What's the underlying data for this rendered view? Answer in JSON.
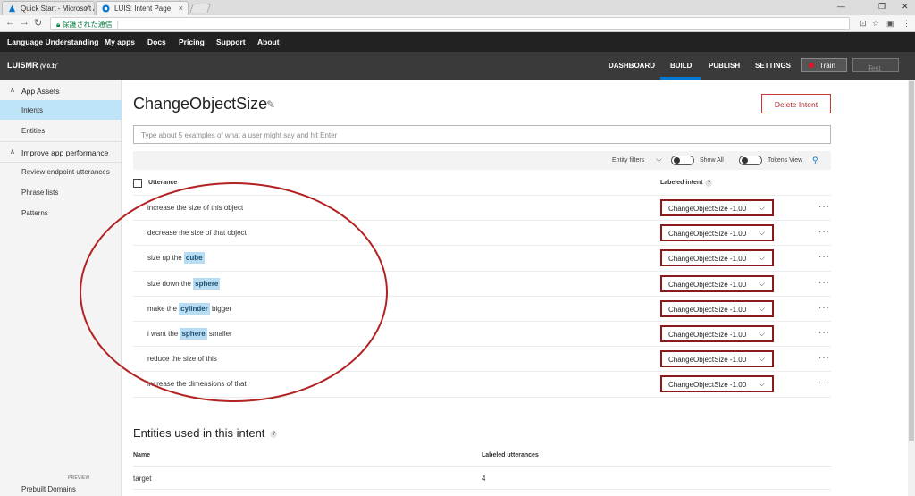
{
  "browser": {
    "tabs": [
      {
        "label": "Quick Start - Microsoft A"
      },
      {
        "label": "LUIS: Intent Page"
      }
    ],
    "url": {
      "secure_label": "保護された通信",
      "icon": "lock-icon"
    }
  },
  "topnav": {
    "brand": "Language Understanding",
    "links": [
      "My apps",
      "Docs",
      "Pricing",
      "Support",
      "About"
    ]
  },
  "appbar": {
    "app_name": "LUISMR",
    "version": "(V 0.1)",
    "tabs": [
      "DASHBOARD",
      "BUILD",
      "PUBLISH",
      "SETTINGS"
    ],
    "active_tab": "BUILD",
    "train_label": "Train",
    "test_label": "Test"
  },
  "sidebar": {
    "section1": "App Assets",
    "items1": [
      "Intents",
      "Entities"
    ],
    "selected": "Intents",
    "section2": "Improve app performance",
    "items2": [
      "Review endpoint utterances",
      "Phrase lists",
      "Patterns"
    ],
    "bottom_item": "Prebuilt Domains",
    "bottom_badge": "PREVIEW"
  },
  "main": {
    "intent_name": "ChangeObjectSize",
    "delete_label": "Delete Intent",
    "placeholder": "Type about 5 examples of what a user might say and hit Enter",
    "filters": {
      "entity_filters": "Entity filters",
      "show_all": "Show All",
      "tokens_view": "Tokens View"
    },
    "headers": {
      "utterance": "Utterance",
      "labeled_intent": "Labeled intent",
      "help": "?"
    },
    "rows": [
      {
        "pre": "increase the size of this object",
        "ent": "",
        "post": "",
        "intent": "ChangeObjectSize -1.00"
      },
      {
        "pre": "decrease the size of that object",
        "ent": "",
        "post": "",
        "intent": "ChangeObjectSize -1.00"
      },
      {
        "pre": "size up the ",
        "ent": "cube",
        "post": "",
        "intent": "ChangeObjectSize -1.00"
      },
      {
        "pre": "size down the ",
        "ent": "sphere",
        "post": "",
        "intent": "ChangeObjectSize -1.00"
      },
      {
        "pre": "make the ",
        "ent": "cylinder",
        "post": " bigger",
        "intent": "ChangeObjectSize -1.00"
      },
      {
        "pre": "i want the ",
        "ent": "sphere",
        "post": " smaller",
        "intent": "ChangeObjectSize -1.00"
      },
      {
        "pre": "reduce the size of this",
        "ent": "",
        "post": "",
        "intent": "ChangeObjectSize -1.00"
      },
      {
        "pre": "increase the dimensions of that",
        "ent": "",
        "post": "",
        "intent": "ChangeObjectSize -1.00"
      }
    ],
    "entities_title": "Entities used in this intent",
    "entities_help": "?",
    "entities_headers": {
      "name": "Name",
      "labeled": "Labeled utterances"
    },
    "entities_rows": [
      {
        "name": "target",
        "count": "4"
      }
    ]
  },
  "colors": {
    "accent": "#0078d4",
    "annotation": "#b22222",
    "intent_border": "#8b1a1a"
  }
}
